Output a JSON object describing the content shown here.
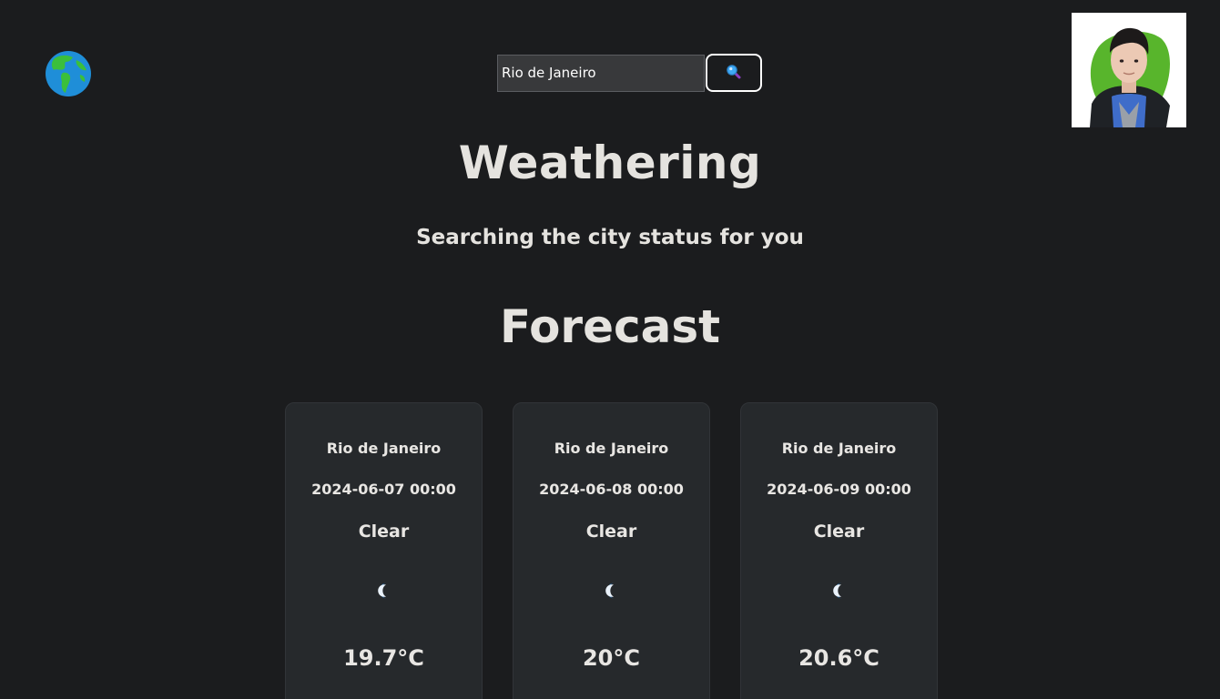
{
  "header": {
    "logo_icon": "globe-americas-icon",
    "search": {
      "value": "Rio de Janeiro",
      "button_icon": "magnifying-glass-icon"
    },
    "avatar_alt": "user-photo"
  },
  "main": {
    "title": "Weathering",
    "subtitle": "Searching the city status for you",
    "forecast_heading": "Forecast",
    "cards": [
      {
        "city": "Rio de Janeiro",
        "datetime": "2024-06-07 00:00",
        "condition": "Clear",
        "icon": "crescent-moon-icon",
        "temperature": "19.7°C"
      },
      {
        "city": "Rio de Janeiro",
        "datetime": "2024-06-08 00:00",
        "condition": "Clear",
        "icon": "crescent-moon-icon",
        "temperature": "20°C"
      },
      {
        "city": "Rio de Janeiro",
        "datetime": "2024-06-09 00:00",
        "condition": "Clear",
        "icon": "crescent-moon-icon",
        "temperature": "20.6°C"
      }
    ]
  },
  "colors": {
    "background": "#1b1c1e",
    "card_background": "#26292c",
    "text": "#e8e6e3",
    "moon": "#1e7fd6"
  }
}
